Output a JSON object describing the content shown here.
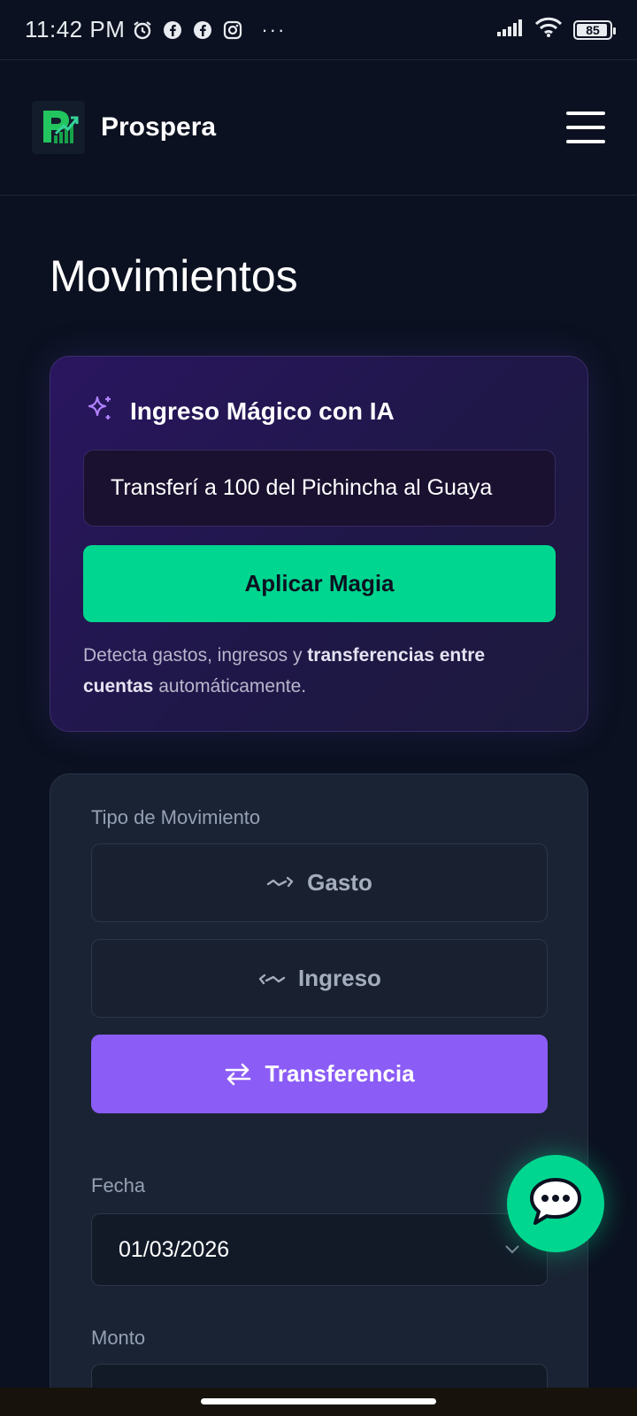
{
  "status_bar": {
    "time": "11:42 PM",
    "notification_icons": [
      "alarm-icon",
      "facebook-icon",
      "facebook-icon",
      "instagram-icon"
    ],
    "more": "···",
    "battery": "85"
  },
  "header": {
    "brand": "Prospera",
    "menu_icon": "hamburger-menu-icon"
  },
  "page": {
    "title": "Movimientos"
  },
  "magic": {
    "title": "Ingreso Mágico con IA",
    "input_value": "Transferí a 100 del Pichincha al Guaya",
    "button_label": "Aplicar Magia",
    "desc_pre": "Detecta gastos, ingresos y ",
    "desc_bold": "transferencias entre cuentas",
    "desc_post": " automáticamente."
  },
  "form": {
    "type_label": "Tipo de Movimiento",
    "types": [
      {
        "label": "Gasto",
        "icon": "trend-down-arrow-icon",
        "active": false
      },
      {
        "label": "Ingreso",
        "icon": "trend-in-arrow-icon",
        "active": false
      },
      {
        "label": "Transferencia",
        "icon": "transfer-arrows-icon",
        "active": true
      }
    ],
    "date_label": "Fecha",
    "date_value": "01/03/2026",
    "amount_label": "Monto"
  },
  "colors": {
    "background": "#0b1120",
    "card": "#1a2333",
    "accent_green": "#00d68f",
    "accent_purple": "#8b5cf6"
  }
}
